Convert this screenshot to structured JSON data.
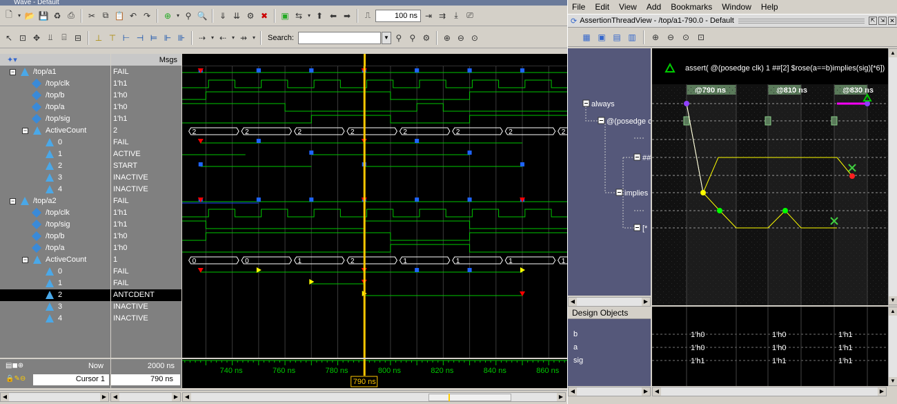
{
  "wave": {
    "title": "Wave - Default",
    "toolbar": {
      "time_value": "100 ns",
      "search_label": "Search:",
      "search_value": ""
    },
    "headers": {
      "msgs": "Msgs"
    },
    "signals": [
      {
        "name": "/top/a1",
        "value": "FAIL",
        "level": 0,
        "kind": "assert",
        "expanded": true
      },
      {
        "name": "/top/clk",
        "value": "1'h1",
        "level": 1,
        "kind": "sig"
      },
      {
        "name": "/top/b",
        "value": "1'h0",
        "level": 1,
        "kind": "sig"
      },
      {
        "name": "/top/a",
        "value": "1'h0",
        "level": 1,
        "kind": "sig"
      },
      {
        "name": "/top/sig",
        "value": "1'h1",
        "level": 1,
        "kind": "sig"
      },
      {
        "name": "ActiveCount",
        "value": "2",
        "level": 1,
        "kind": "assert",
        "expanded": true
      },
      {
        "name": "0",
        "value": "FAIL",
        "level": 2,
        "kind": "assert"
      },
      {
        "name": "1",
        "value": "ACTIVE",
        "level": 2,
        "kind": "assert"
      },
      {
        "name": "2",
        "value": "START",
        "level": 2,
        "kind": "assert"
      },
      {
        "name": "3",
        "value": "INACTIVE",
        "level": 2,
        "kind": "assert"
      },
      {
        "name": "4",
        "value": "INACTIVE",
        "level": 2,
        "kind": "assert"
      },
      {
        "name": "/top/a2",
        "value": "FAIL",
        "level": 0,
        "kind": "assert",
        "expanded": true
      },
      {
        "name": "/top/clk",
        "value": "1'h1",
        "level": 1,
        "kind": "sig"
      },
      {
        "name": "/top/sig",
        "value": "1'h1",
        "level": 1,
        "kind": "sig"
      },
      {
        "name": "/top/b",
        "value": "1'h0",
        "level": 1,
        "kind": "sig"
      },
      {
        "name": "/top/a",
        "value": "1'h0",
        "level": 1,
        "kind": "sig"
      },
      {
        "name": "ActiveCount",
        "value": "1",
        "level": 1,
        "kind": "assert",
        "expanded": true
      },
      {
        "name": "0",
        "value": "FAIL",
        "level": 2,
        "kind": "assert"
      },
      {
        "name": "1",
        "value": "FAIL",
        "level": 2,
        "kind": "assert"
      },
      {
        "name": "2",
        "value": "ANTCDENT",
        "level": 2,
        "kind": "assert",
        "selected": true
      },
      {
        "name": "3",
        "value": "INACTIVE",
        "level": 2,
        "kind": "assert"
      },
      {
        "name": "4",
        "value": "INACTIVE",
        "level": 2,
        "kind": "assert"
      }
    ],
    "bus_labels_a1": [
      "2",
      "2",
      "2",
      "2",
      "2",
      "2",
      "2",
      "2"
    ],
    "bus_labels_a2": [
      "0",
      "0",
      "1",
      "2",
      "1",
      "1",
      "1",
      "1"
    ],
    "status": {
      "now_label": "Now",
      "now_value": "2000 ns",
      "cursor_label": "Cursor 1",
      "cursor_value": "790 ns",
      "cursor_flag": "790 ns"
    },
    "ticks": [
      "740 ns",
      "760 ns",
      "780 ns",
      "800 ns",
      "820 ns",
      "840 ns",
      "860 ns"
    ],
    "colors": {
      "wave": "#00c800",
      "cursor": "#ffc800",
      "marker": "#1e64ff",
      "fail": "#ff0000",
      "pass": "#00ff00"
    }
  },
  "atv": {
    "menu": [
      "File",
      "Edit",
      "View",
      "Add",
      "Bookmarks",
      "Window",
      "Help"
    ],
    "title": "AssertionThreadView - /top/a1-790.0 - Default",
    "assertion": "assert( @(posedge clk) 1 ##[2] $rose(a==b)implies(sig)[*6])",
    "time_headers": [
      "@790 ns",
      "@810 ns",
      "@830 ns"
    ],
    "tree": [
      {
        "label": "always"
      },
      {
        "label": "@(posedge c"
      },
      {
        "label": "##"
      },
      {
        "label": "implies"
      },
      {
        "label": "[*"
      }
    ],
    "design_objects_label": "Design Objects",
    "design_objects": [
      {
        "name": "b",
        "values": [
          "1'h0",
          "1'h0",
          "1'h1"
        ]
      },
      {
        "name": "a",
        "values": [
          "1'h0",
          "1'h0",
          "1'h1"
        ]
      },
      {
        "name": "sig",
        "values": [
          "1'h1",
          "1'h1",
          "1'h1"
        ]
      }
    ]
  }
}
